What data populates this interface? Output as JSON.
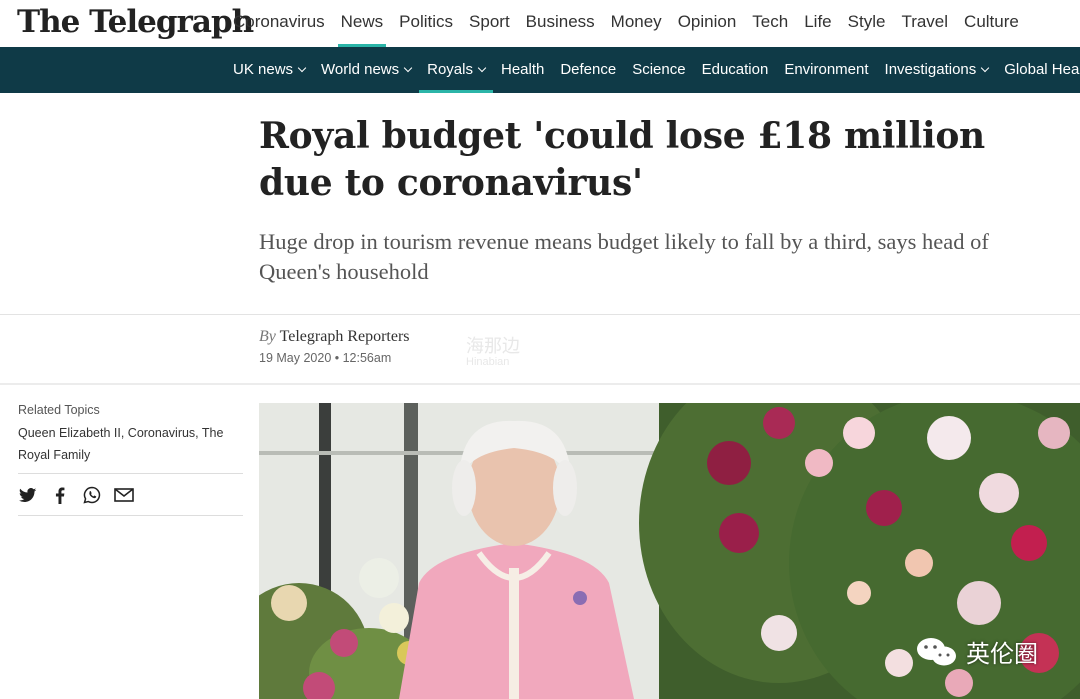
{
  "site": {
    "logo": "The Telegraph"
  },
  "primary_nav": [
    {
      "label": "Coronavirus",
      "active": false
    },
    {
      "label": "News",
      "active": true
    },
    {
      "label": "Politics",
      "active": false
    },
    {
      "label": "Sport",
      "active": false
    },
    {
      "label": "Business",
      "active": false
    },
    {
      "label": "Money",
      "active": false
    },
    {
      "label": "Opinion",
      "active": false
    },
    {
      "label": "Tech",
      "active": false
    },
    {
      "label": "Life",
      "active": false
    },
    {
      "label": "Style",
      "active": false
    },
    {
      "label": "Travel",
      "active": false
    },
    {
      "label": "Culture",
      "active": false
    }
  ],
  "secondary_nav": [
    {
      "label": "UK news",
      "dropdown": true
    },
    {
      "label": "World news",
      "dropdown": true
    },
    {
      "label": "Royals",
      "dropdown": true,
      "active": true
    },
    {
      "label": "Health"
    },
    {
      "label": "Defence"
    },
    {
      "label": "Science"
    },
    {
      "label": "Education"
    },
    {
      "label": "Environment"
    },
    {
      "label": "Investigations",
      "dropdown": true
    },
    {
      "label": "Global Health"
    }
  ],
  "article": {
    "headline": "Royal budget 'could lose £18 million due to coronavirus'",
    "standfirst": "Huge drop in tourism revenue means budget likely to fall by a third, says head of Queen's household",
    "byline_prefix": "By",
    "byline_author": "Telegraph Reporters",
    "date": "19 May 2020 • 12:56am"
  },
  "sidebar": {
    "related_label": "Related Topics",
    "related_topics": "Queen Elizabeth II, Coronavirus, The Royal Family",
    "share_icons": [
      "twitter-icon",
      "facebook-icon",
      "whatsapp-icon",
      "email-icon"
    ]
  },
  "watermarks": {
    "overlay_cn": "海那边",
    "overlay_en": "Hinabian",
    "badge": "英伦圈"
  },
  "colors": {
    "accent": "#2bb5a8",
    "secondary_nav_bg": "#0f3a47"
  }
}
